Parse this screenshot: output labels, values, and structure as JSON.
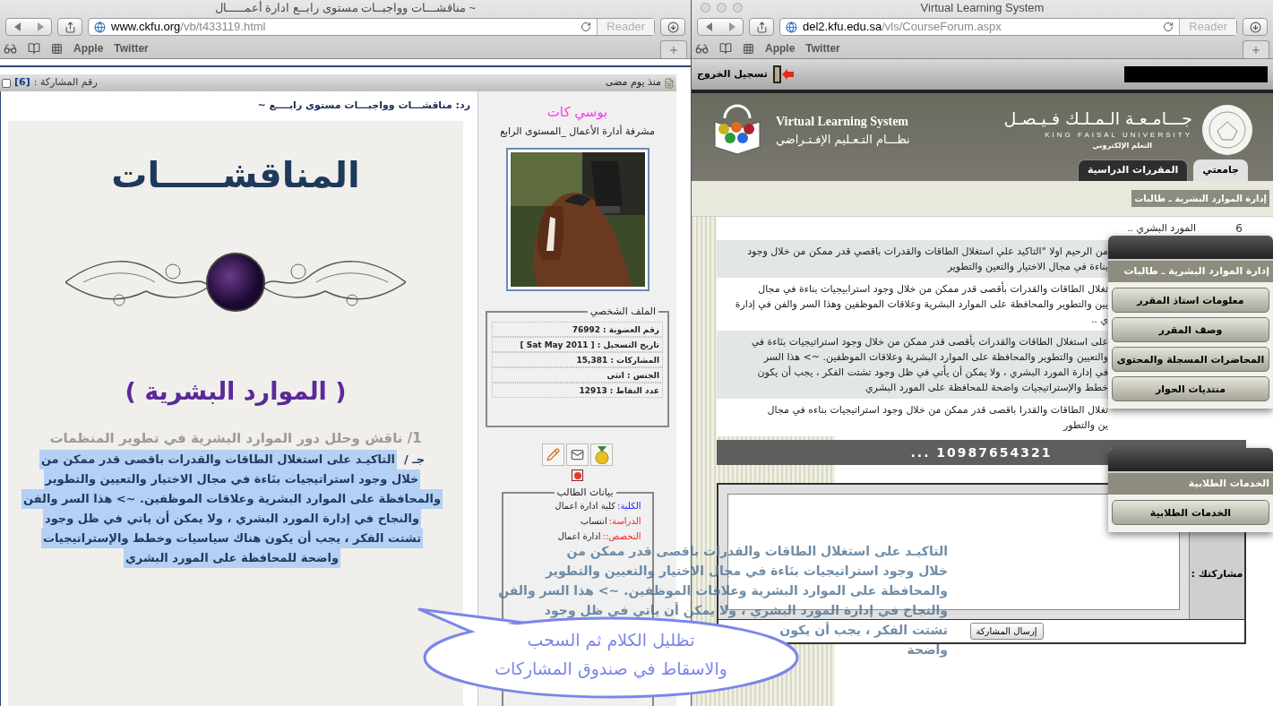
{
  "left_window": {
    "title": "مناقشـــات وواجبــات مستوى رابــع ادارة أعمـــــال ~",
    "url_host": "www.ckfu.org",
    "url_path": "/vb/t433119.html",
    "reader": "Reader",
    "bookmarks": [
      "Twitter",
      "Apple"
    ],
    "post": {
      "time": "منذ يوم مضى",
      "number_label": "رقم المشاركة :",
      "number": "[6]",
      "checked": false,
      "reply_title": "رد: مناقشـــات وواجبـــات مستوى رابــــع ~",
      "author": {
        "name": "بوسي كات",
        "role": "مشرفة أدارة الأعمال _المستوى الرابع",
        "profile_title": "الملف الشخصي",
        "profile_rows": [
          "رقم العضوية : 76992",
          "تاريخ التسجيل : [ Sat May 2011 ]",
          "المشاركات : 15,381",
          "الجنس : انثى",
          "عدد النقاط : 12913"
        ],
        "student_title": "بيانات الطالب",
        "student_rows": [
          {
            "label": "الكلية:",
            "value": "كلية ادارة اعمال",
            "color": "#2222ee"
          },
          {
            "label": "الدراسة:",
            "value": "انتساب",
            "color": "#ee2222"
          },
          {
            "label": "التخصص::",
            "value": "ادارة اعمال",
            "color": "#ee2222"
          }
        ]
      },
      "image": {
        "heading": "المناقشـــــات",
        "subheading": "( الموارد البشرية )",
        "question": "1/ ناقش وحلل دور الموارد البشرية في تطوير المنظمات",
        "answer_prefix": "جـ /",
        "selected": true,
        "answer_lines": [
          "التاكيـد على استغلال الطاقات والقدرات باقصى قدر ممكن من",
          "خلال وجود استراتيجيات بنَاءة في مجال الاختيار والتعيين والتطوير",
          "والمحافظة على الموارد البشرية وعلاقات الموظفين. ~> هذا السر والفن",
          "والنجاح في إدارة المورد البشري ، ولا يمكن أن ياتي في ظل وجود",
          "تشتت الفكر ، يجب أن يكون هناك سياسيات وخطط والإستراتيجيات",
          "واضحة للمحافظة على المورد البشري"
        ]
      }
    }
  },
  "right_window": {
    "title": "Virtual Learning System",
    "url_host": "del2.kfu.edu.sa",
    "url_path": "/vls/CourseForum.aspx",
    "reader": "Reader",
    "bookmarks": [
      "Twitter",
      "Apple"
    ],
    "logout": "تسجيل الخروج",
    "vls_title": "Virtual Learning System",
    "vls_subtitle": "نظـــام التـعـليم الإفـتـراضي",
    "university_ar": "جـــامـعـة الـمـلـك فـيـصـل",
    "university_en": "KING FAISAL UNIVERSITY",
    "unit": "التعلم الإلكتروني",
    "tabs": [
      {
        "label": "جامعتي",
        "selected": true
      },
      {
        "label": "المقررات الدراسية",
        "selected": false
      }
    ],
    "breadcrumb": "إدارة الموارد البشرية ـ طالبات",
    "posts": [
      {
        "number": "6",
        "lines": [
          "المورد البشري .."
        ]
      },
      {
        "lines": [
          "من الرحيم اولا \"التاكيد علي استغلال الطاقات والقدرات باقصي قدر ممكن من خلال وجود",
          "بناءة في مجال الاختيار والتعين والتطوير"
        ]
      },
      {
        "lines": [
          "تغلال الطاقات والقدرات بأقصى قدر ممكن من خلال وجود استرابيجيات بناءة في مجال",
          "يين والتطوير والمحافظة على الموارد البشرية وعلاقات الموظفين وهذا السر والفن في إدارة",
          "ي .."
        ]
      },
      {
        "lines": [
          "على استغلال الطاقات والقدرات بأقصى قدر ممكن من خلال وجود استراتيجيات بنَاءة في",
          "والتعيين والتطوير والمحافظة على الموارد البشرية وعلاقات الموظفين. ~> هذا السر",
          "في إدارة المورد البشري ، ولا يمكن أن يأتي في ظل وجود تشتت الفكر ، يجب أن يكون",
          "خطط والإستراتيجيات واضحة للمحافظة على المورد البشري"
        ]
      },
      {
        "lines": [
          "تغلال الطاقات والقدرا باقصى قدر ممكن من خلال وجود استراتيجيات بناءه في مجال",
          "ين والتطور"
        ]
      }
    ],
    "pagination": "10987654321 ...",
    "reply_label": "مشاركتك :",
    "send": "إرسال المشاركة",
    "menus": [
      {
        "title": "إدارة الموارد البشرية ـ طالبات",
        "items": [
          "معلومات استاذ المقرر",
          "وصف المقرر",
          "المحاضرات المسجلة والمحتوى",
          "منتديات الحوار"
        ]
      },
      {
        "title": "الخدمات الطلابية",
        "items": [
          "الخدمات الطلابية"
        ]
      }
    ]
  },
  "overlays": {
    "drag_text": [
      "التاكيـد على استغلال الطاقات والقدرات باقصى قدر ممكن من",
      "خلال وجود استراتيجيات بنَاءة في مجال الاختيار والتعيين والتطوير",
      "والمحافظة على الموارد البشرية وعلاقات الموظفين. ~> هذا السر والفن",
      "والنجاح في إدارة المورد البشري ، ولا يمكن أن ياتي في ظل وجود",
      "تشتت الفكر ، يجب أن يكون",
      "واضحة"
    ],
    "callout": [
      "تظليل الكلام ثم السحب",
      "والاسقاط في صندوق المشاركات"
    ]
  }
}
